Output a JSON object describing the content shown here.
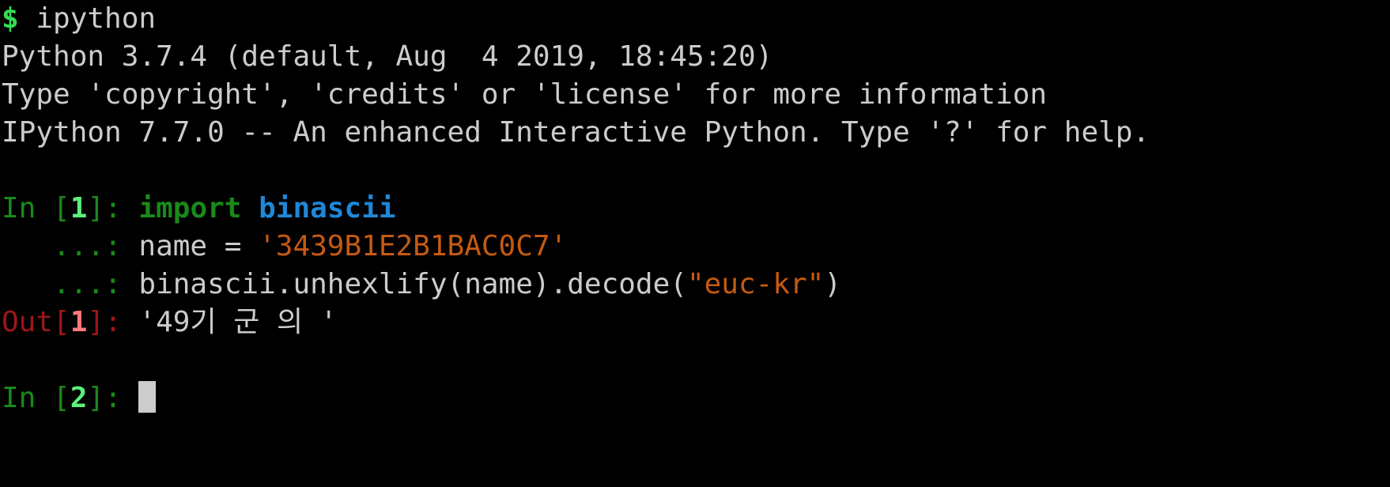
{
  "terminal": {
    "background_color": "#000000",
    "foreground_color": "#cccccc",
    "title": "ipython terminal session",
    "colors": {
      "prompt_green": "#33dd55",
      "in_prompt_dark_green": "#1a8a1a",
      "in_number_bright_green": "#5cf07c",
      "out_prompt_dark_red": "#9e1616",
      "out_number_bright_red": "#fa7b7b",
      "keyword_green": "#1a8a1a",
      "module_blue": "#1f87d8",
      "string_orange": "#c55a11",
      "cursor_gray": "#cccccc"
    }
  },
  "lines": {
    "shell_prompt": {
      "symbol": "$",
      "command": " ipython"
    },
    "banner": {
      "python_version": "Python 3.7.4 (default, Aug  4 2019, 18:45:20)",
      "copyright_hint": "Type 'copyright', 'credits' or 'license' for more information",
      "ipython_version": "IPython 7.7.0 -- An enhanced Interactive Python. Type '?' for help."
    },
    "cell_1": {
      "prompt_prefix": "In [",
      "prompt_number": "1",
      "prompt_suffix": "]: ",
      "code_line_1_keyword": "import",
      "code_line_1_space": " ",
      "code_line_1_module": "binascii",
      "continuation_prompt": "   ...: ",
      "code_line_2_assign": "name = ",
      "code_line_2_string": "'3439B1E2B1BAC0C7'",
      "code_line_3_call_a": "binascii.unhexlify(name).decode(",
      "code_line_3_encoding": "\"euc-kr\"",
      "code_line_3_call_b": ")"
    },
    "output_1": {
      "prompt_prefix": "Out[",
      "prompt_number": "1",
      "prompt_suffix": "]: ",
      "value": "'49기 군 의 '"
    },
    "cell_2": {
      "prompt_prefix": "In [",
      "prompt_number": "2",
      "prompt_suffix": "]: "
    }
  }
}
